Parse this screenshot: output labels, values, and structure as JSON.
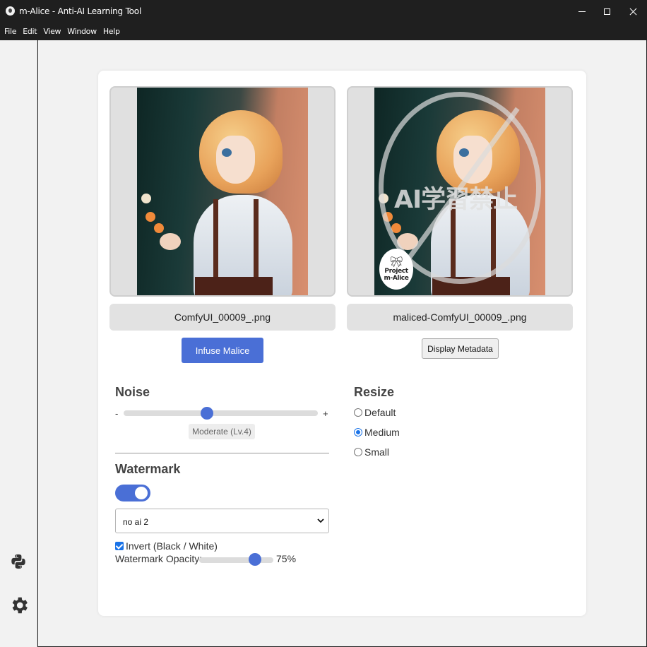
{
  "window": {
    "title": "m-Alice - Anti-AI Learning Tool"
  },
  "menu": [
    "File",
    "Edit",
    "View",
    "Window",
    "Help"
  ],
  "sidebar": {
    "icons": [
      "python-icon",
      "gear-icon"
    ]
  },
  "images": {
    "original_filename": "ComfyUI_00009_.png",
    "processed_filename": "maliced-ComfyUI_00009_.png",
    "watermark_overlay_text": "AI学習禁止",
    "badge_line1": "Project",
    "badge_line2": "m-Alice"
  },
  "actions": {
    "infuse_label": "Infuse Malice",
    "metadata_label": "Display Metadata"
  },
  "noise": {
    "title": "Noise",
    "minus": "-",
    "plus": "+",
    "level_text": "Moderate (Lv.4)",
    "level_fraction": 0.43
  },
  "watermark": {
    "title": "Watermark",
    "enabled": true,
    "selected": "no ai 2",
    "invert_label": "Invert (Black / White)",
    "invert_checked": true,
    "opacity_label": "Watermark Opacity:",
    "opacity_value": "75%",
    "opacity_fraction": 0.75
  },
  "resize": {
    "title": "Resize",
    "options": [
      "Default",
      "Medium",
      "Small"
    ],
    "selected": "Medium"
  },
  "colors": {
    "accent": "#4a6fd6",
    "titlebar": "#1f1f1f",
    "background": "#f2f2f2"
  }
}
